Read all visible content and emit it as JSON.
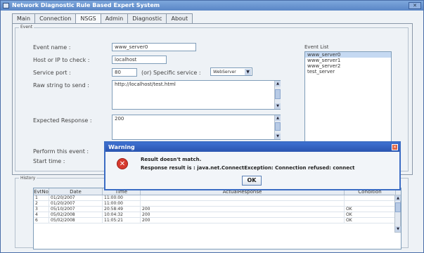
{
  "window": {
    "title": "Network Diagnostic Rule Based Expert System"
  },
  "tabs": [
    {
      "label": "Main"
    },
    {
      "label": "Connection"
    },
    {
      "label": "NSGS"
    },
    {
      "label": "Admin"
    },
    {
      "label": "Diagnostic"
    },
    {
      "label": "About"
    }
  ],
  "event_group": {
    "title": "Event",
    "event_name_label": "Event name :",
    "event_name_value": "www_server0",
    "host_label": "Host or IP to check :",
    "host_value": "localhost",
    "port_label": "Service port :",
    "port_value": "80",
    "specific_service_label": "(or) Specific service :",
    "specific_service_value": "WebServer",
    "raw_string_label": "Raw string to send :",
    "raw_string_value": "http://localhost/test.html",
    "expected_label": "Expected Response :",
    "expected_value": "200",
    "perform_label": "Perform this event :",
    "start_label": "Start time :"
  },
  "event_list": {
    "title": "Event List",
    "items": [
      "www_server0",
      "www_server1",
      "www_server2",
      "test_server"
    ]
  },
  "history": {
    "title": "History",
    "columns": [
      "EvtNo",
      "Date",
      "Time",
      "ActualResponse",
      "Condition"
    ],
    "rows": [
      [
        "1",
        "01/20/2007",
        "11:00:00",
        "",
        ""
      ],
      [
        "2",
        "01/20/2007",
        "11:00:00",
        "",
        ""
      ],
      [
        "3",
        "05/10/2007",
        "20:58:49",
        "200",
        "OK"
      ],
      [
        "4",
        "05/02/2008",
        "10:04:32",
        "200",
        "OK"
      ],
      [
        "6",
        "05/02/2008",
        "11:05:21",
        "200",
        "OK"
      ]
    ]
  },
  "dialog": {
    "title": "Warning",
    "message_line1": "Result doesn't match.",
    "message_line2": "Response result is : java.net.ConnectException: Connection refused: connect",
    "ok_label": "OK"
  }
}
